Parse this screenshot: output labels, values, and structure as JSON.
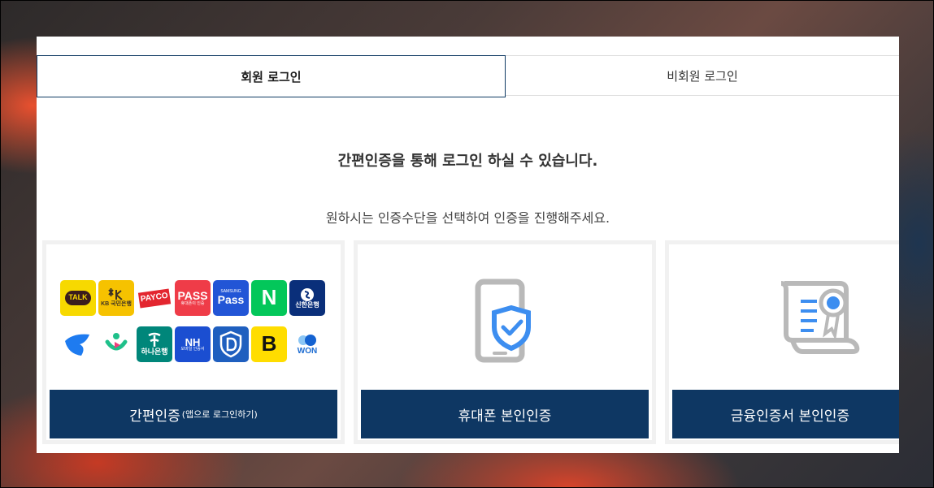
{
  "tabs": [
    {
      "label": "회원 로그인",
      "active": true
    },
    {
      "label": "비회원 로그인",
      "active": false
    }
  ],
  "headline": "간편인증을 통해 로그인 하실 수 있습니다.",
  "subline": "원하시는 인증수단을 선택하여 인증을 진행해주세요.",
  "cards": [
    {
      "label": "간편인증",
      "note": "(앱으로 로그인하기)"
    },
    {
      "label": "휴대폰 본인인증"
    },
    {
      "label": "금융인증서 본인인증"
    }
  ],
  "logos": {
    "kakao": "TALK",
    "kb": "KB 국민은행",
    "payco": "PAYCO",
    "pass": "PASS",
    "pass_sub": "휴대폰이 인증",
    "samsung_top": "SAMSUNG",
    "samsung": "Pass",
    "naver": "N",
    "shinhan": "신한은행",
    "hana": "하나은행",
    "nh": "NH",
    "nh_sub": "모바일 인증서",
    "banksalad": "B",
    "won": "WON"
  },
  "colors": {
    "primary": "#0e3763",
    "tab_border": "#0f3a63",
    "icon_gray": "#b9b9b9",
    "icon_blue": "#3d8ef0"
  }
}
